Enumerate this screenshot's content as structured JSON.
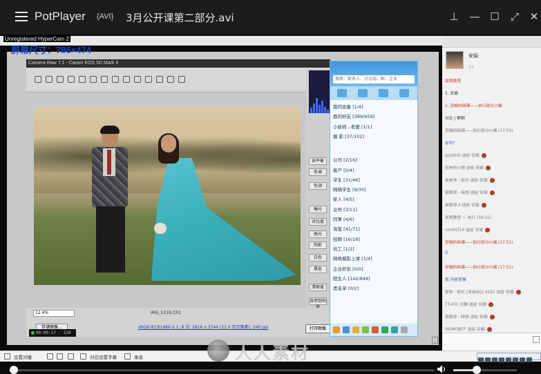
{
  "titlebar": {
    "app_name": "PotPlayer",
    "format": "{AVI}",
    "file_name": "3月公开课第二部分.avi"
  },
  "recorder": {
    "tag": "Unregistered HyperCam 2",
    "size_label": "屏幕尺寸：786×474",
    "time": "00:09:17 · 220"
  },
  "camera_raw": {
    "title": "Camera Raw 7.1 - Canon EOS 5D Mark II",
    "zoom": "12.4%",
    "filename": "IMG_5318.CR2",
    "info": "sRGB IEC61966-2.1; 8 位; 5616 x 3744 (21.0 百万像素); 240 ppi",
    "save_button": "存储图像...",
    "open_button": "打开图像",
    "side_buttons": [
      "自平衡",
      "色调",
      "色调",
      "曝光",
      "对比度",
      "高光",
      "阴影",
      "白色",
      "黑色",
      "清晰度",
      "自然饱和度",
      "饱和度"
    ]
  },
  "qq": {
    "search_placeholder": "搜索：联系人、讨论组、群、企业",
    "groups": [
      "我的设备 [1/4]",
      "我的好友 [389/659]",
      "小蚯蚓...老婆 [1/1]",
      "摄 影 [37/102]",
      "公司 [2/16]",
      "客户 [0/4]",
      "学生 [31/46]",
      "网络学生 [9/30]",
      "家人 [4/5]",
      "业务 [3/11]",
      "同事 [4/6]",
      "淘宝 [41/71]",
      "招聘 [16/18]",
      "员工 [1/2]",
      "网络摄影上课 [1/4]",
      "企业好友 [0/0]",
      "陌生人 [142/848]",
      "黑名单 [0/2]"
    ]
  },
  "chat": {
    "user": "安娟",
    "sub": "12",
    "section": "讨论 | 群聊",
    "lines": [
      {
        "text": "发视教室",
        "style": "red"
      },
      {
        "text": "1. 安娟",
        "style": ""
      },
      {
        "text": "2. 安娟的网课——执行部分小编",
        "style": "red"
      },
      {
        "text": "讨论 | 群聊",
        "style": ""
      },
      {
        "text": "安娟的网课——执行部分小编 (17:50)",
        "style": "gray"
      },
      {
        "text": "在吗？",
        "style": "blue"
      },
      {
        "text": "qvzbbl5 送给 安娟",
        "style": "gray"
      },
      {
        "text": "狂奔的小肥 送给 安娟",
        "style": "gray"
      },
      {
        "text": "徐老师 - 和乐 送给 安娟",
        "style": "gray"
      },
      {
        "text": "郭毅师 - 特想 送给 安娟",
        "style": "gray"
      },
      {
        "text": "郭毅师-ll 送给 安娟",
        "style": "gray"
      },
      {
        "text": "发视教室 — 执行 (16:31)",
        "style": "gray"
      },
      {
        "text": "nick0l314 送给 安娟",
        "style": "gray"
      },
      {
        "text": "安娟的网课——执行部分小编 (17:51)",
        "style": "red"
      },
      {
        "text": "G",
        "style": "blue"
      },
      {
        "text": "安娟的网课——执行部分小编 (17:51)",
        "style": "red"
      },
      {
        "text": "我 问放宫事",
        "style": "blue"
      },
      {
        "text": "郭帅 - 凯红 [来自QQ] 4292 送给 安娟",
        "style": "gray"
      },
      {
        "text": "TT-401 天麟 送给 安娟",
        "style": "gray"
      },
      {
        "text": "郭毅师 - 特想 送给 安娟",
        "style": "gray"
      },
      {
        "text": "MOMO娘子 送给 安娟",
        "style": "gray"
      }
    ]
  },
  "status_bar": {
    "settings": "设置对播",
    "subtitle": "对应设置字幕",
    "record": "录音"
  },
  "playback": {
    "progress": 0.01,
    "volume": 0.37
  },
  "watermark": "人人素材"
}
